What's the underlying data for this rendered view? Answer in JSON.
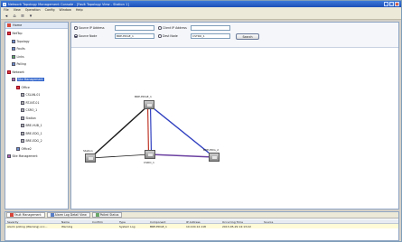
{
  "window": {
    "title": "Network Topology Management Console - [Fault Topology View - Station 1]"
  },
  "menu": [
    "File",
    "View",
    "Operation",
    "Config",
    "Window",
    "Help"
  ],
  "toolbar": {
    "icons": [
      "back-icon",
      "home-icon",
      "filter-icon",
      "tool-icon"
    ]
  },
  "sidebar": {
    "header": "Home",
    "tree": [
      {
        "label": "NetTop",
        "icon": "red",
        "indent": 0
      },
      {
        "label": "Topology",
        "icon": "blue",
        "indent": 1
      },
      {
        "label": "Faults",
        "icon": "blue",
        "indent": 1
      },
      {
        "label": "Links",
        "icon": "green",
        "indent": 1
      },
      {
        "label": "Polling",
        "icon": "blue",
        "indent": 1
      },
      {
        "label": "Network",
        "icon": "red",
        "indent": 0
      },
      {
        "label": "Site Management",
        "icon": "purple",
        "indent": 1,
        "selected": true
      },
      {
        "label": "Office",
        "icon": "red",
        "indent": 2
      },
      {
        "label": "CSLAN-01",
        "icon": "gray",
        "indent": 3
      },
      {
        "label": "RT-INT-01",
        "icon": "gray",
        "indent": 3
      },
      {
        "label": "CSRO_1",
        "icon": "gray",
        "indent": 3
      },
      {
        "label": "Station",
        "icon": "gray",
        "indent": 3
      },
      {
        "label": "BRE-HUB_1",
        "icon": "gray",
        "indent": 3
      },
      {
        "label": "BRE-EDG_1",
        "icon": "gray",
        "indent": 3
      },
      {
        "label": "BRE-EDG_2",
        "icon": "gray",
        "indent": 3
      },
      {
        "label": "Office2",
        "icon": "blue",
        "indent": 2
      },
      {
        "label": "Site Management",
        "icon": "purple",
        "indent": 0
      }
    ]
  },
  "filter": {
    "source_ip_label": "Source IP Address",
    "source_ip_value": "",
    "client_ip_label": "Client IP Address",
    "client_ip_value": "",
    "source_node_label": "Source Node",
    "source_node_value": "BRE-EDGE_1",
    "dest_node_label": "Dest Node",
    "dest_node_value": "CSTRO_1",
    "search_label": "Search"
  },
  "topology": {
    "nodes": [
      {
        "id": "hub",
        "label": "BRE-EDGE_1"
      },
      {
        "id": "left",
        "label": "Station"
      },
      {
        "id": "center",
        "label": "CSRO_1"
      },
      {
        "id": "right",
        "label": "BRE-EDG_2"
      }
    ],
    "link_colors": {
      "black": "#1a1a1a",
      "red": "#c0392b",
      "blue": "#3040c0",
      "purple": "#6a3fa0"
    }
  },
  "bottom": {
    "tabs": [
      {
        "label": "Fault Management",
        "icon": "r",
        "active": true
      },
      {
        "label": "Alarm Log Detail View",
        "icon": "b",
        "active": false
      },
      {
        "label": "Polled Status",
        "icon": "g",
        "active": false
      }
    ],
    "columns": [
      "Severity",
      "Name",
      "Confirm",
      "Type",
      "Component",
      "IP Address",
      "Occurring Time",
      "Source"
    ],
    "rows": [
      [
        "Alarm polling (Warning) occ...",
        "Warning",
        "",
        "System Log",
        "BRE-EDGE_1",
        "10.100.12.118",
        "2013-05-29 14:13:22",
        ""
      ]
    ]
  }
}
